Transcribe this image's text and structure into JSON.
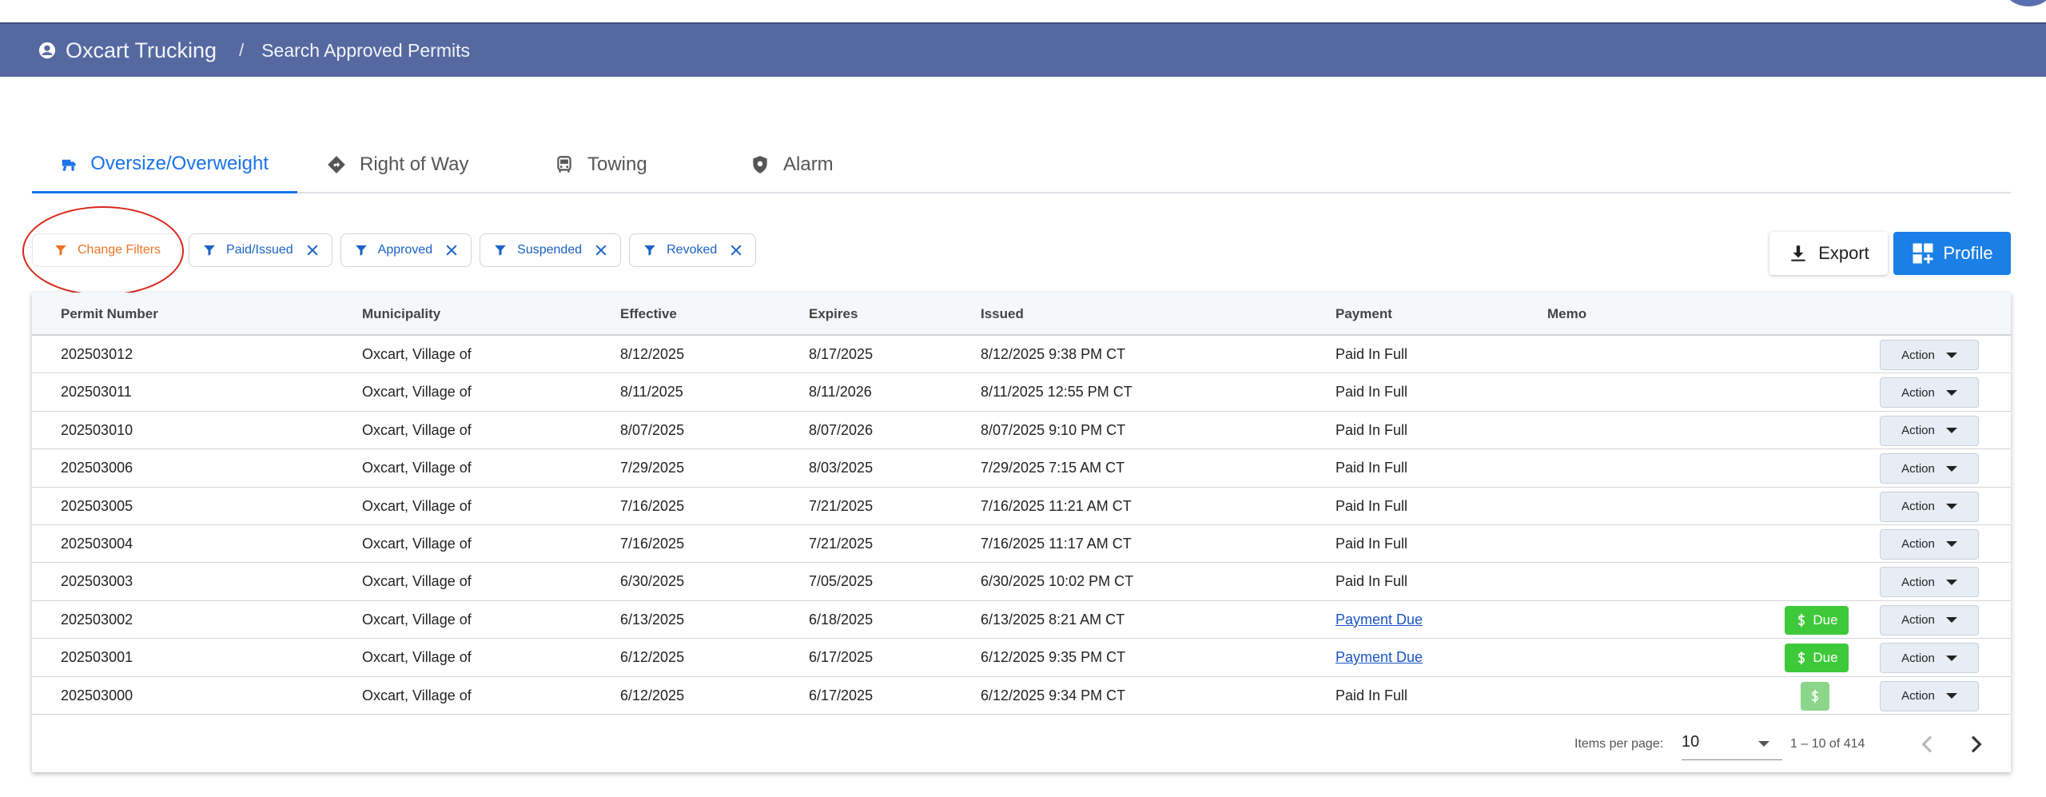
{
  "header": {
    "brand": "Oxcart Trucking",
    "separator": "/",
    "breadcrumb": "Search Approved Permits"
  },
  "tabs": [
    {
      "label": "Oversize/Overweight",
      "icon": "truck-icon",
      "active": true
    },
    {
      "label": "Right of Way",
      "icon": "diamond-direction-icon",
      "active": false
    },
    {
      "label": "Towing",
      "icon": "tow-vehicle-icon",
      "active": false
    },
    {
      "label": "Alarm",
      "icon": "shield-icon",
      "active": false
    }
  ],
  "filters": {
    "change_label": "Change Filters",
    "chips": [
      "Paid/Issued",
      "Approved",
      "Suspended",
      "Revoked"
    ]
  },
  "toolbar": {
    "export_label": "Export",
    "profile_label": "Profile"
  },
  "table": {
    "columns": [
      "Permit Number",
      "Municipality",
      "Effective",
      "Expires",
      "Issued",
      "Payment",
      "Memo"
    ],
    "action_label": "Action",
    "due_label": "Due",
    "rows": [
      {
        "permit": "202503012",
        "municipality": "Oxcart, Village of",
        "effective": "8/12/2025",
        "expires": "8/17/2025",
        "issued": "8/12/2025 9:38 PM CT",
        "payment": "Paid In Full",
        "due": "none"
      },
      {
        "permit": "202503011",
        "municipality": "Oxcart, Village of",
        "effective": "8/11/2025",
        "expires": "8/11/2026",
        "issued": "8/11/2025 12:55 PM CT",
        "payment": "Paid In Full",
        "due": "none"
      },
      {
        "permit": "202503010",
        "municipality": "Oxcart, Village of",
        "effective": "8/07/2025",
        "expires": "8/07/2026",
        "issued": "8/07/2025 9:10 PM CT",
        "payment": "Paid In Full",
        "due": "none"
      },
      {
        "permit": "202503006",
        "municipality": "Oxcart, Village of",
        "effective": "7/29/2025",
        "expires": "8/03/2025",
        "issued": "7/29/2025 7:15 AM CT",
        "payment": "Paid In Full",
        "due": "none"
      },
      {
        "permit": "202503005",
        "municipality": "Oxcart, Village of",
        "effective": "7/16/2025",
        "expires": "7/21/2025",
        "issued": "7/16/2025 11:21 AM CT",
        "payment": "Paid In Full",
        "due": "none"
      },
      {
        "permit": "202503004",
        "municipality": "Oxcart, Village of",
        "effective": "7/16/2025",
        "expires": "7/21/2025",
        "issued": "7/16/2025 11:17 AM CT",
        "payment": "Paid In Full",
        "due": "none"
      },
      {
        "permit": "202503003",
        "municipality": "Oxcart, Village of",
        "effective": "6/30/2025",
        "expires": "7/05/2025",
        "issued": "6/30/2025 10:02 PM CT",
        "payment": "Paid In Full",
        "due": "none"
      },
      {
        "permit": "202503002",
        "municipality": "Oxcart, Village of",
        "effective": "6/13/2025",
        "expires": "6/18/2025",
        "issued": "6/13/2025 8:21 AM CT",
        "payment": "Payment Due",
        "due": "badge"
      },
      {
        "permit": "202503001",
        "municipality": "Oxcart, Village of",
        "effective": "6/12/2025",
        "expires": "6/17/2025",
        "issued": "6/12/2025 9:35 PM CT",
        "payment": "Payment Due",
        "due": "badge"
      },
      {
        "permit": "202503000",
        "municipality": "Oxcart, Village of",
        "effective": "6/12/2025",
        "expires": "6/17/2025",
        "issued": "6/12/2025 9:34 PM CT",
        "payment": "Paid In Full",
        "due": "icon"
      }
    ]
  },
  "paginator": {
    "items_per_page_label": "Items per page:",
    "items_per_page": "10",
    "range": "1 – 10 of 414"
  },
  "colors": {
    "header_bg": "#5568a0",
    "accent": "#1a73e8",
    "profile_bg": "#1a7fe6",
    "change_filters": "#e87425",
    "due_green": "#3ec93a",
    "highlight_ring": "#d9261c"
  }
}
